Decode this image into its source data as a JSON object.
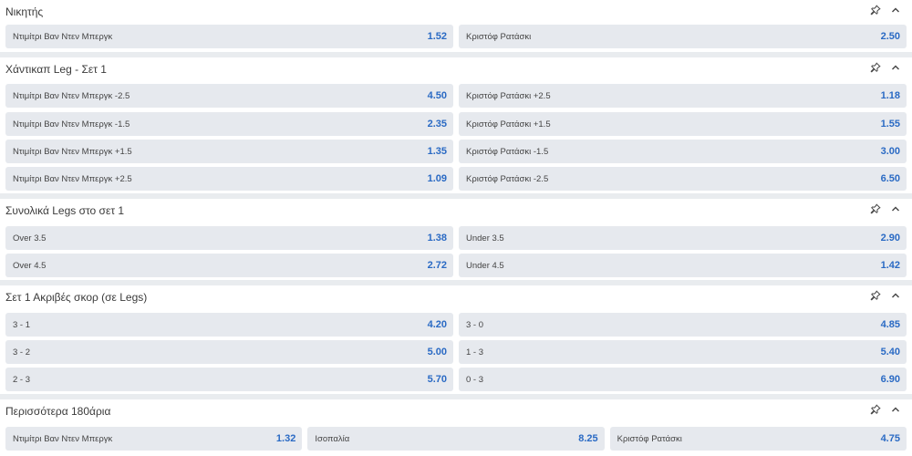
{
  "markets": [
    {
      "title": "Νικητής",
      "rows": [
        [
          {
            "label": "Ντιμίτρι Βαν Ντεν Μπεργκ",
            "odd": "1.52"
          },
          {
            "label": "Κριστόφ Ρατάσκι",
            "odd": "2.50"
          }
        ]
      ]
    },
    {
      "title": "Χάντικαπ Leg - Σετ 1",
      "rows": [
        [
          {
            "label": "Ντιμίτρι Βαν Ντεν Μπεργκ -2.5",
            "odd": "4.50"
          },
          {
            "label": "Κριστόφ Ρατάσκι +2.5",
            "odd": "1.18"
          }
        ],
        [
          {
            "label": "Ντιμίτρι Βαν Ντεν Μπεργκ -1.5",
            "odd": "2.35"
          },
          {
            "label": "Κριστόφ Ρατάσκι +1.5",
            "odd": "1.55"
          }
        ],
        [
          {
            "label": "Ντιμίτρι Βαν Ντεν Μπεργκ +1.5",
            "odd": "1.35"
          },
          {
            "label": "Κριστόφ Ρατάσκι -1.5",
            "odd": "3.00"
          }
        ],
        [
          {
            "label": "Ντιμίτρι Βαν Ντεν Μπεργκ +2.5",
            "odd": "1.09"
          },
          {
            "label": "Κριστόφ Ρατάσκι -2.5",
            "odd": "6.50"
          }
        ]
      ]
    },
    {
      "title": "Συνολικά Legs στο σετ 1",
      "rows": [
        [
          {
            "label": "Over 3.5",
            "odd": "1.38"
          },
          {
            "label": "Under 3.5",
            "odd": "2.90"
          }
        ],
        [
          {
            "label": "Over 4.5",
            "odd": "2.72"
          },
          {
            "label": "Under 4.5",
            "odd": "1.42"
          }
        ]
      ]
    },
    {
      "title": "Σετ 1 Ακριβές σκορ (σε Legs)",
      "rows": [
        [
          {
            "label": "3 - 1",
            "odd": "4.20"
          },
          {
            "label": "3 - 0",
            "odd": "4.85"
          }
        ],
        [
          {
            "label": "3 - 2",
            "odd": "5.00"
          },
          {
            "label": "1 - 3",
            "odd": "5.40"
          }
        ],
        [
          {
            "label": "2 - 3",
            "odd": "5.70"
          },
          {
            "label": "0 - 3",
            "odd": "6.90"
          }
        ]
      ]
    },
    {
      "title": "Περισσότερα 180άρια",
      "rows": [
        [
          {
            "label": "Ντιμίτρι Βαν Ντεν Μπεργκ",
            "odd": "1.32"
          },
          {
            "label": "Ισοπαλία",
            "odd": "8.25"
          },
          {
            "label": "Κριστόφ Ρατάσκι",
            "odd": "4.75"
          }
        ]
      ]
    }
  ],
  "icons": {
    "pin": "pin-icon",
    "collapse": "chevron-up-icon"
  },
  "colors": {
    "odd": "#2a6ac4",
    "cell": "#e6e9ee",
    "background": "#e9ecef"
  }
}
